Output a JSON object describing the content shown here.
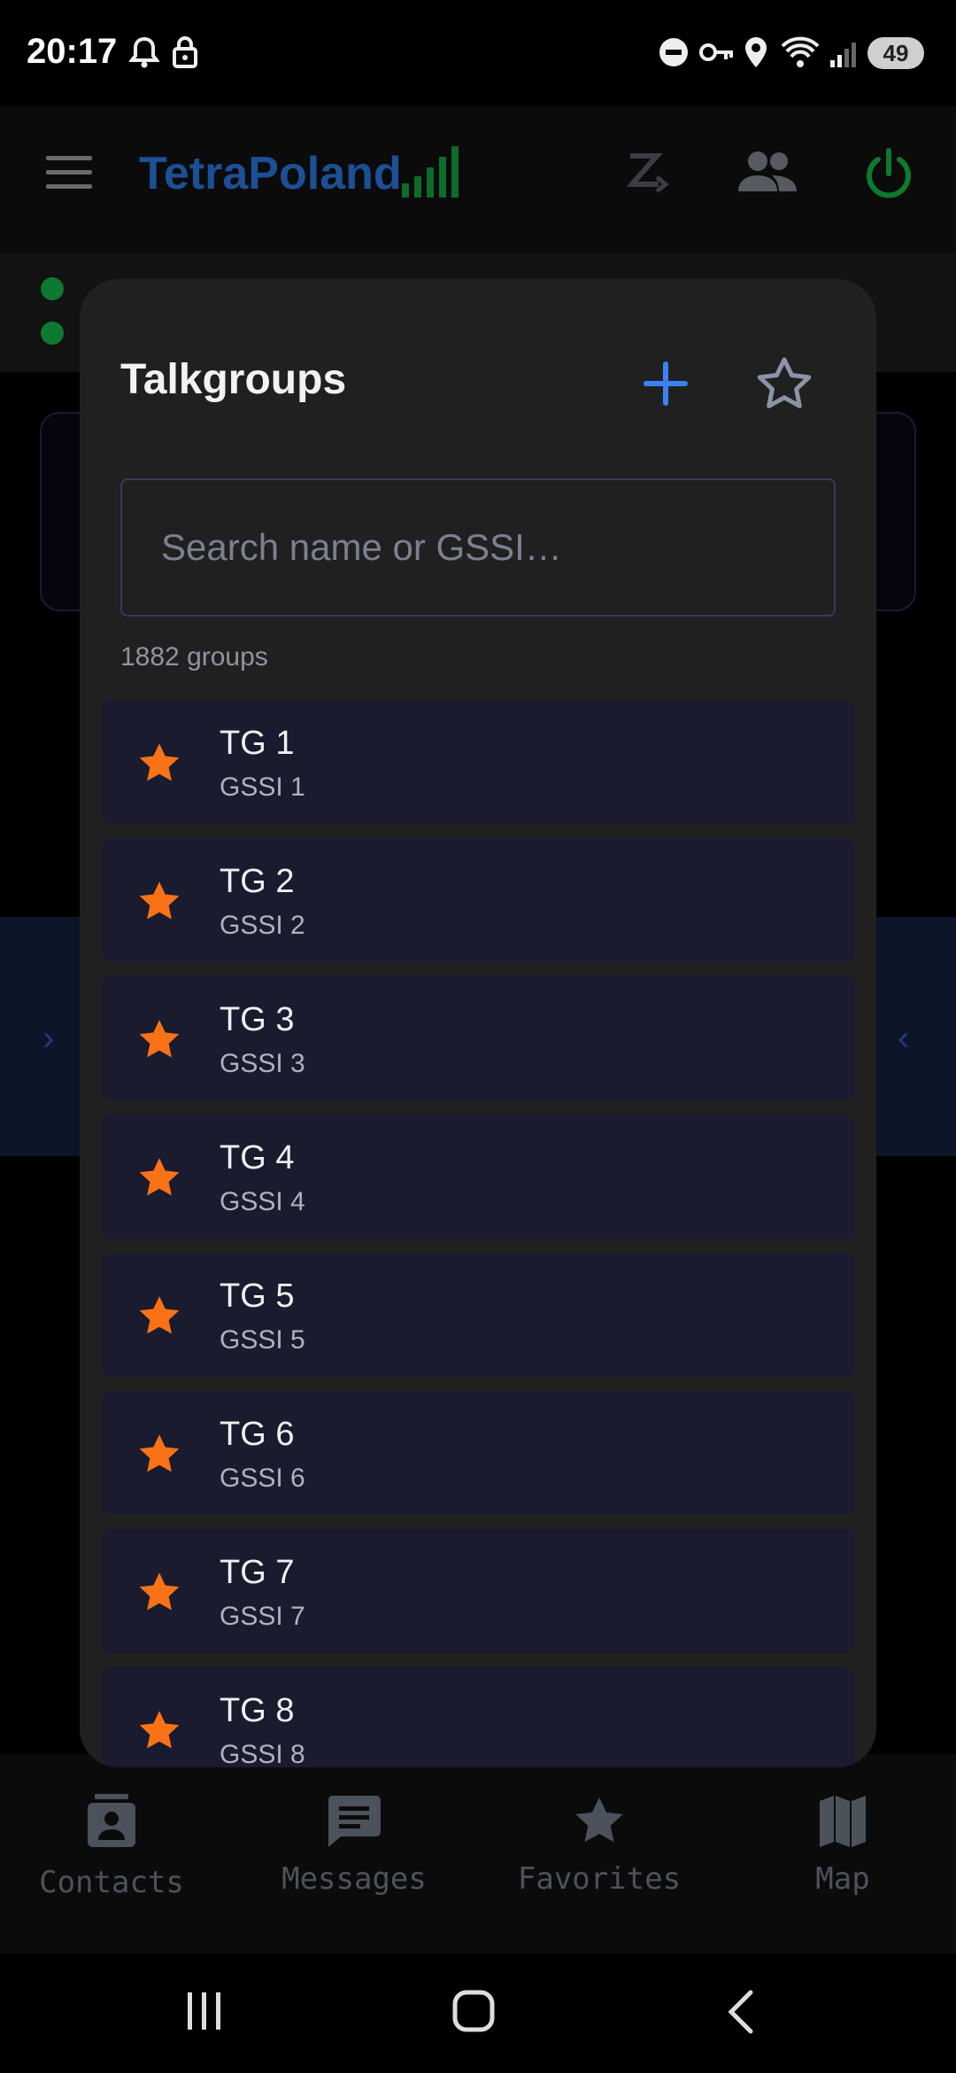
{
  "status_bar": {
    "time": "20:17",
    "battery": "49",
    "icons": [
      "alarm-icon",
      "lock-icon",
      "dnd-icon",
      "key-icon",
      "location-icon",
      "wifi-icon",
      "cell-signal-icon"
    ]
  },
  "app": {
    "title": "TetraPoland",
    "title_color": "#1d4f96",
    "signal_color": "#0e6b2c",
    "power_color": "#0d7a2e"
  },
  "modal": {
    "title": "Talkgroups",
    "search_placeholder": "Search name or GSSI…",
    "count_label": "1882 groups",
    "accent": "#3b82f6",
    "star_color": "#f97316",
    "items": [
      {
        "name": "TG 1",
        "gssi": "GSSI 1",
        "favorite": true
      },
      {
        "name": "TG 2",
        "gssi": "GSSI 2",
        "favorite": true
      },
      {
        "name": "TG 3",
        "gssi": "GSSI 3",
        "favorite": true
      },
      {
        "name": "TG 4",
        "gssi": "GSSI 4",
        "favorite": true
      },
      {
        "name": "TG 5",
        "gssi": "GSSI 5",
        "favorite": true
      },
      {
        "name": "TG 6",
        "gssi": "GSSI 6",
        "favorite": true
      },
      {
        "name": "TG 7",
        "gssi": "GSSI 7",
        "favorite": true
      },
      {
        "name": "TG 8",
        "gssi": "GSSI 8",
        "favorite": true
      }
    ]
  },
  "bottom_nav": [
    {
      "label": "Contacts",
      "icon": "contacts-icon"
    },
    {
      "label": "Messages",
      "icon": "messages-icon"
    },
    {
      "label": "Favorites",
      "icon": "star-icon"
    },
    {
      "label": "Map",
      "icon": "map-icon"
    }
  ]
}
